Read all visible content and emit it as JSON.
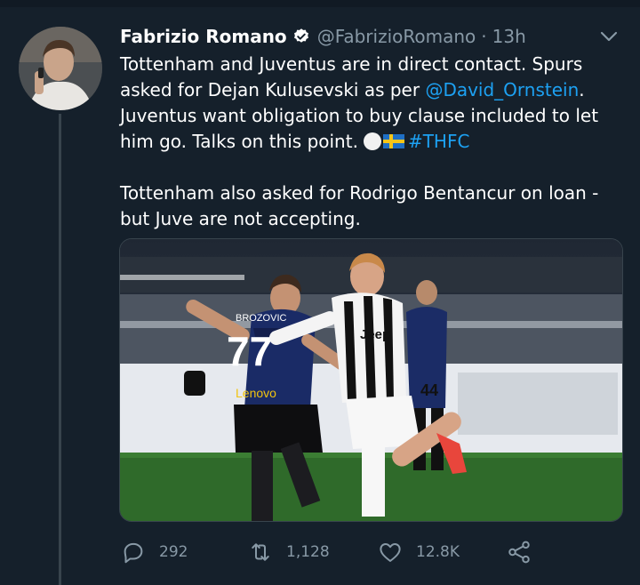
{
  "tweet": {
    "author_name": "Fabrizio Romano",
    "handle": "@FabrizioRomano",
    "separator": "·",
    "time": "13h",
    "text_part1": "Tottenham and Juventus are in direct contact. Spurs asked for Dejan Kulusevski as per ",
    "mention": "@David_Ornstein",
    "text_part2": ". Juventus want obligation to buy clause included to let him go. Talks on this point.",
    "hashtag": "#THFC",
    "paragraph2": "Tottenham also asked for Rodrigo Bentancur on loan - but Juve are not accepting."
  },
  "media": {
    "jersey_number_left": "77",
    "shirt_name_left": "BROZOVIC",
    "sponsor_left": "Lenovo",
    "sponsor_right": "Jeep",
    "jersey_number_right": "44"
  },
  "actions": {
    "replies": "292",
    "retweets": "1,128",
    "likes": "12.8K"
  },
  "icons": {
    "verified": "verified-badge-icon",
    "more": "chevron-down-icon",
    "reply": "reply-icon",
    "retweet": "retweet-icon",
    "like": "heart-icon",
    "share": "share-icon"
  },
  "colors": {
    "background": "#15202b",
    "accent": "#1da1f2",
    "muted": "#8899a6"
  }
}
